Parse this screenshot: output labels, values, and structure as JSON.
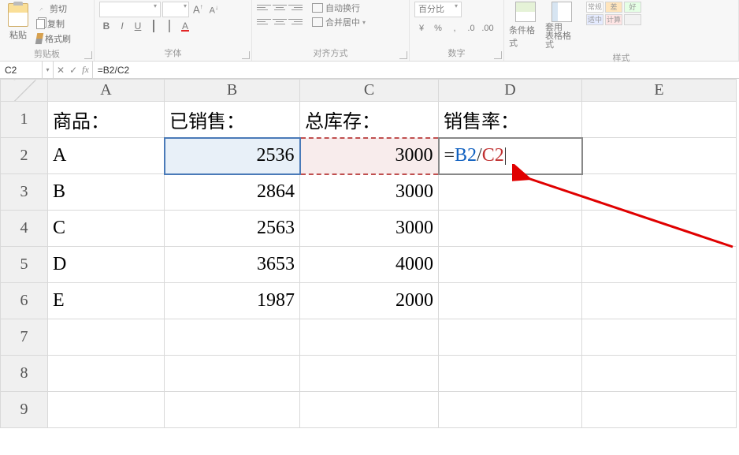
{
  "ribbon": {
    "clipboard": {
      "paste": "粘贴",
      "cut": "剪切",
      "copy": "复制",
      "format_painter": "格式刷",
      "group": "剪贴板"
    },
    "font": {
      "family": "",
      "size": "",
      "biggerA": "A",
      "smallerA": "A",
      "group": "字体"
    },
    "align": {
      "wrap": "自动换行",
      "merge": "合并居中",
      "group": "对齐方式"
    },
    "number": {
      "format": "百分比",
      "group": "数字"
    },
    "styles": {
      "cond": "条件格式",
      "tbl": "套用\n表格格式",
      "sw1": "常规",
      "sw2": "差",
      "sw3": "好",
      "sw4": "适中",
      "sw5": "计算",
      "sw6": "",
      "group": "样式"
    }
  },
  "formulaBar": {
    "nameBox": "C2",
    "formula": "=B2/C2"
  },
  "grid": {
    "cols": [
      "A",
      "B",
      "C",
      "D",
      "E"
    ],
    "rows": [
      "1",
      "2",
      "3",
      "4",
      "5",
      "6",
      "7",
      "8",
      "9"
    ],
    "headers": {
      "A": "商品：",
      "B": "已销售：",
      "C": "总库存：",
      "D": "销售率："
    },
    "data": [
      {
        "product": "A",
        "sold": "2536",
        "stock": "3000"
      },
      {
        "product": "B",
        "sold": "2864",
        "stock": "3000"
      },
      {
        "product": "C",
        "sold": "2563",
        "stock": "3000"
      },
      {
        "product": "D",
        "sold": "3653",
        "stock": "4000"
      },
      {
        "product": "E",
        "sold": "1987",
        "stock": "2000"
      }
    ],
    "formula_in_d2": {
      "eq": "=",
      "ref_b": "B2",
      "slash": "/",
      "ref_c": "C2"
    }
  }
}
